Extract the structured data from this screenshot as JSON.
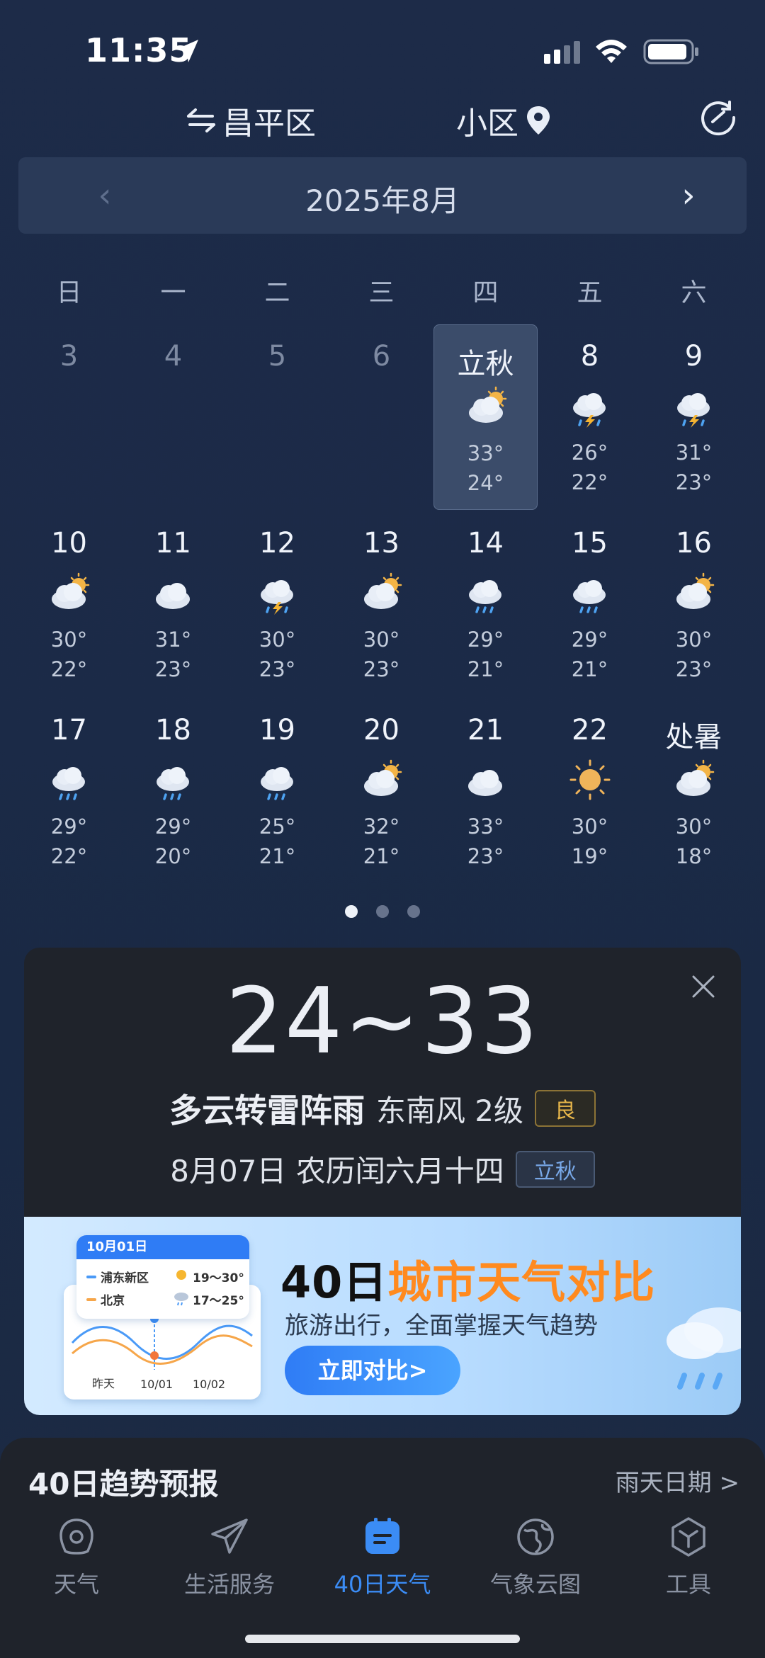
{
  "status_bar": {
    "time": "11:35"
  },
  "header": {
    "city": "昌平区",
    "community": "小区"
  },
  "calendar": {
    "month_title": "2025年8月",
    "weekdays": [
      "日",
      "一",
      "二",
      "三",
      "四",
      "五",
      "六"
    ],
    "weeks": [
      [
        {
          "label": "3",
          "past": true
        },
        {
          "label": "4",
          "past": true
        },
        {
          "label": "5",
          "past": true
        },
        {
          "label": "6",
          "past": true
        },
        {
          "label": "立秋",
          "icon": "partly-cloudy-icon",
          "hi": "33°",
          "lo": "24°",
          "selected": true
        },
        {
          "label": "8",
          "icon": "thunderstorm-icon",
          "hi": "26°",
          "lo": "22°"
        },
        {
          "label": "9",
          "icon": "thunderstorm-icon",
          "hi": "31°",
          "lo": "23°"
        }
      ],
      [
        {
          "label": "10",
          "icon": "partly-cloudy-icon",
          "hi": "30°",
          "lo": "22°"
        },
        {
          "label": "11",
          "icon": "cloudy-icon",
          "hi": "31°",
          "lo": "23°"
        },
        {
          "label": "12",
          "icon": "thunderstorm-icon",
          "hi": "30°",
          "lo": "23°"
        },
        {
          "label": "13",
          "icon": "partly-cloudy-icon",
          "hi": "30°",
          "lo": "23°"
        },
        {
          "label": "14",
          "icon": "rain-icon",
          "hi": "29°",
          "lo": "21°"
        },
        {
          "label": "15",
          "icon": "rain-icon",
          "hi": "29°",
          "lo": "21°"
        },
        {
          "label": "16",
          "icon": "partly-cloudy-icon",
          "hi": "30°",
          "lo": "23°"
        }
      ],
      [
        {
          "label": "17",
          "icon": "rain-icon",
          "hi": "29°",
          "lo": "22°"
        },
        {
          "label": "18",
          "icon": "rain-icon",
          "hi": "29°",
          "lo": "20°"
        },
        {
          "label": "19",
          "icon": "rain-icon",
          "hi": "25°",
          "lo": "21°"
        },
        {
          "label": "20",
          "icon": "partly-cloudy-icon",
          "hi": "32°",
          "lo": "21°"
        },
        {
          "label": "21",
          "icon": "cloudy-icon",
          "hi": "33°",
          "lo": "23°"
        },
        {
          "label": "22",
          "icon": "sunny-icon",
          "hi": "30°",
          "lo": "19°"
        },
        {
          "label": "处暑",
          "icon": "partly-cloudy-icon",
          "hi": "30°",
          "lo": "18°"
        }
      ]
    ],
    "page_count": 3,
    "active_page": 0
  },
  "detail": {
    "temp_range": "24~33",
    "condition": "多云转雷阵雨",
    "wind": "东南风 2级",
    "aqi": "良",
    "date": "8月07日 农历闰六月十四",
    "solar_term": "立秋"
  },
  "banner": {
    "card_date": "10月01日",
    "city1": "浦东新区",
    "city1_temp": "19～30°",
    "city2": "北京",
    "city2_temp": "17～25°",
    "x_labels": [
      "昨天",
      "10/01",
      "10/02"
    ],
    "title_part1": "40日",
    "title_part2": "城市天气对比",
    "subtitle": "旅游出行，全面掌握天气趋势",
    "button": "立即对比>"
  },
  "trend": {
    "title": "40日趋势预报",
    "link": "雨天日期 >"
  },
  "tabs": [
    {
      "label": "天气",
      "icon": "weather-tab-icon"
    },
    {
      "label": "生活服务",
      "icon": "paper-plane-icon"
    },
    {
      "label": "40日天气",
      "icon": "calendar-tab-icon",
      "active": true
    },
    {
      "label": "气象云图",
      "icon": "globe-icon"
    },
    {
      "label": "工具",
      "icon": "tools-icon"
    }
  ],
  "colors": {
    "background": "#1c2a46",
    "accent": "#3b8cf5",
    "aqi": "#e6b54a",
    "banner_highlight": "#ff8a1f"
  }
}
